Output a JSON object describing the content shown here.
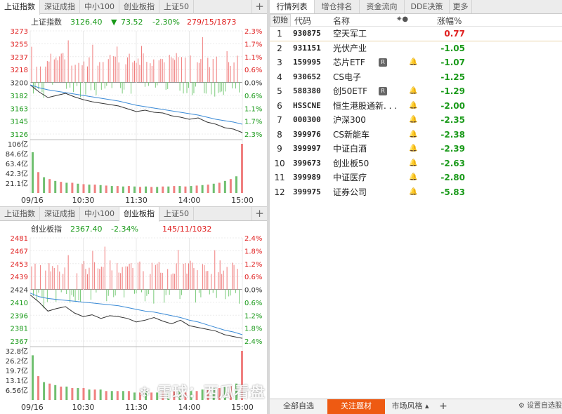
{
  "colors": {
    "up": "#e02020",
    "down": "#1a9a1a",
    "price_line": "#333333",
    "avg_line": "#3a8ad6",
    "accent": "#ee5a12"
  },
  "left_top": {
    "tabs": [
      "上证指数",
      "深证成指",
      "中小100",
      "创业板指",
      "上证50"
    ],
    "active_tab": 0,
    "info": {
      "name": "上证指数",
      "price": "3126.40",
      "arrow": "▼",
      "change": "73.52",
      "change_pct": "-2.30%",
      "breadth": "279/15/1873"
    }
  },
  "left_bottom": {
    "tabs": [
      "上证指数",
      "深证成指",
      "中小100",
      "创业板指",
      "上证50"
    ],
    "active_tab": 3,
    "info": {
      "name": "创业板指",
      "price": "2367.40",
      "arrow": "",
      "change": "",
      "change_pct": "-2.34%",
      "breadth": "145/11/1032"
    }
  },
  "plus_label": "+",
  "chart_data": [
    {
      "type": "line",
      "title": "上证指数",
      "y_ticks_left": [
        "3273",
        "3255",
        "3237",
        "3218",
        "3200",
        "3182",
        "3163",
        "3145",
        "3126"
      ],
      "y_ticks_right": [
        "2.3%",
        "1.7%",
        "1.1%",
        "0.6%",
        "0.0%",
        "0.6%",
        "1.1%",
        "1.7%",
        "2.3%"
      ],
      "base": 3200,
      "ylim": [
        3126,
        3273
      ],
      "x_ticks": [
        "09/16",
        "10:30",
        "11:30",
        "14:00",
        "15:00"
      ],
      "volume_ticks": [
        "106亿",
        "84.6亿",
        "63.4亿",
        "42.3亿",
        "21.1亿"
      ],
      "series": [
        {
          "x": [
            0,
            10,
            20,
            30,
            40,
            50,
            60,
            70,
            80,
            90,
            100,
            110,
            120,
            130,
            140,
            150,
            160,
            170,
            180,
            190,
            200,
            210,
            220,
            230,
            240
          ],
          "values": [
            3196,
            3186,
            3178,
            3181,
            3184,
            3179,
            3175,
            3172,
            3170,
            3168,
            3166,
            3162,
            3158,
            3160,
            3157,
            3156,
            3152,
            3150,
            3147,
            3149,
            3143,
            3140,
            3135,
            3133,
            3128
          ]
        },
        {
          "x": [
            0,
            10,
            20,
            30,
            40,
            50,
            60,
            70,
            80,
            90,
            100,
            110,
            120,
            130,
            140,
            150,
            160,
            170,
            180,
            190,
            200,
            210,
            220,
            230,
            240
          ],
          "values": [
            3196,
            3192,
            3189,
            3187,
            3185,
            3183,
            3181,
            3179,
            3177,
            3175,
            3173,
            3170,
            3167,
            3165,
            3163,
            3161,
            3159,
            3157,
            3155,
            3153,
            3150,
            3147,
            3145,
            3143,
            3140
          ]
        }
      ],
      "volume": [
        88,
        45,
        34,
        30,
        26,
        24,
        22,
        22,
        20,
        19,
        18,
        18,
        17,
        16,
        15,
        15,
        14,
        15,
        14,
        13,
        14,
        13,
        13,
        14,
        14,
        15,
        15,
        14,
        15,
        16,
        17,
        18,
        20,
        22,
        26,
        30,
        36,
        106
      ]
    },
    {
      "type": "line",
      "title": "创业板指",
      "y_ticks_left": [
        "2481",
        "2467",
        "2453",
        "2439",
        "2424",
        "2410",
        "2396",
        "2381",
        "2367"
      ],
      "y_ticks_right": [
        "2.4%",
        "1.8%",
        "1.2%",
        "0.6%",
        "0.0%",
        "0.6%",
        "1.2%",
        "1.8%",
        "2.4%"
      ],
      "base": 2424,
      "ylim": [
        2367,
        2481
      ],
      "x_ticks": [
        "09/16",
        "10:30",
        "11:30",
        "14:00",
        "15:00"
      ],
      "volume_ticks": [
        "32.8亿",
        "26.2亿",
        "19.7亿",
        "13.1亿",
        "6.56亿"
      ],
      "series": [
        {
          "x": [
            0,
            10,
            20,
            30,
            40,
            50,
            60,
            70,
            80,
            90,
            100,
            110,
            120,
            130,
            140,
            150,
            160,
            170,
            180,
            190,
            200,
            210,
            220,
            230,
            240
          ],
          "values": [
            2418,
            2410,
            2400,
            2403,
            2405,
            2398,
            2394,
            2396,
            2392,
            2395,
            2394,
            2392,
            2388,
            2390,
            2393,
            2389,
            2386,
            2390,
            2384,
            2382,
            2380,
            2378,
            2374,
            2372,
            2370
          ]
        },
        {
          "x": [
            0,
            10,
            20,
            30,
            40,
            50,
            60,
            70,
            80,
            90,
            100,
            110,
            120,
            130,
            140,
            150,
            160,
            170,
            180,
            190,
            200,
            210,
            220,
            230,
            240
          ],
          "values": [
            2420,
            2416,
            2414,
            2413,
            2412,
            2411,
            2410,
            2409,
            2408,
            2407,
            2406,
            2404,
            2402,
            2400,
            2399,
            2397,
            2395,
            2393,
            2390,
            2388,
            2385,
            2382,
            2379,
            2377,
            2374
          ]
        }
      ],
      "volume": [
        30,
        16,
        12,
        11,
        10,
        9,
        9,
        8,
        8,
        8,
        7,
        7,
        7,
        6,
        6,
        6,
        6,
        6,
        5,
        5,
        6,
        5,
        5,
        6,
        5,
        6,
        6,
        5,
        6,
        6,
        7,
        7,
        8,
        8,
        9,
        10,
        11,
        33
      ]
    }
  ],
  "right": {
    "tabs": [
      "行情列表",
      "增仓排名",
      "资金流向",
      "DDE决策",
      "更多"
    ],
    "active_tab": 0,
    "init_label": "初始",
    "col_code": "代码",
    "col_name": "名称",
    "col_icons": "✷●",
    "col_change": "涨幅%",
    "rows": [
      {
        "idx": "1",
        "code": "930875",
        "name": "空天军工",
        "badge": "",
        "bell": "",
        "change": "0.77",
        "dir": "up"
      },
      {
        "idx": "2",
        "code": "931151",
        "name": "光伏产业",
        "badge": "",
        "bell": "",
        "change": "-1.05",
        "dir": "down"
      },
      {
        "idx": "3",
        "code": "159995",
        "name": "芯片ETF",
        "badge": "R",
        "bell": "🔔",
        "change": "-1.07",
        "dir": "down"
      },
      {
        "idx": "4",
        "code": "930652",
        "name": "CS电子",
        "badge": "",
        "bell": "",
        "change": "-1.25",
        "dir": "down"
      },
      {
        "idx": "5",
        "code": "588380",
        "name": "创50ETF",
        "badge": "R",
        "bell": "🔔",
        "change": "-1.29",
        "dir": "down"
      },
      {
        "idx": "6",
        "code": "HSSCNE",
        "name": "恒生港股通新. . .",
        "badge": "",
        "bell": "🔔",
        "change": "-2.00",
        "dir": "down"
      },
      {
        "idx": "7",
        "code": "000300",
        "name": "沪深300",
        "badge": "",
        "bell": "🔔",
        "change": "-2.35",
        "dir": "down"
      },
      {
        "idx": "8",
        "code": "399976",
        "name": "CS新能车",
        "badge": "",
        "bell": "🔔",
        "change": "-2.38",
        "dir": "down"
      },
      {
        "idx": "9",
        "code": "399997",
        "name": "中证白酒",
        "badge": "",
        "bell": "🔔",
        "change": "-2.39",
        "dir": "down"
      },
      {
        "idx": "10",
        "code": "399673",
        "name": "创业板50",
        "badge": "",
        "bell": "🔔",
        "change": "-2.63",
        "dir": "down"
      },
      {
        "idx": "11",
        "code": "399989",
        "name": "中证医疗",
        "badge": "",
        "bell": "🔔",
        "change": "-2.80",
        "dir": "down"
      },
      {
        "idx": "12",
        "code": "399975",
        "name": "证券公司",
        "badge": "",
        "bell": "🔔",
        "change": "-5.83",
        "dir": "down"
      }
    ],
    "bottom_tabs": [
      "全部自选",
      "关注题材",
      "市场风格 ▴",
      "+"
    ],
    "bottom_active": 1,
    "settings_label": "⚙ 设置自选股",
    "watermark": "❄ 雪球：西瓜看盘"
  }
}
